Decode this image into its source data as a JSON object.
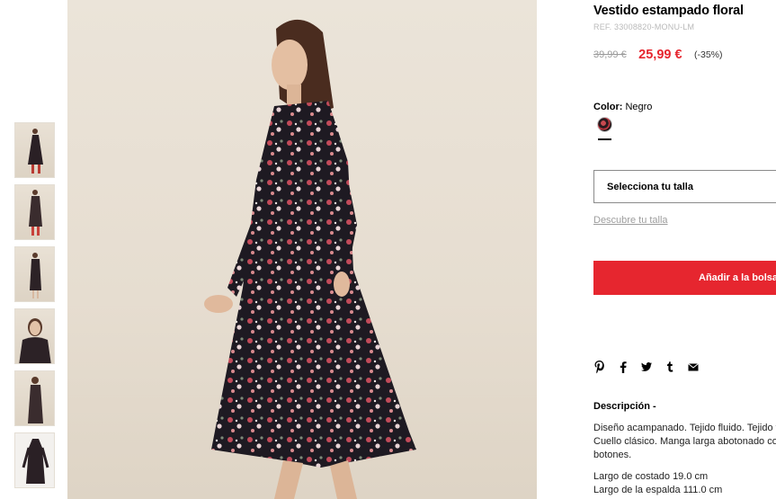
{
  "product": {
    "title": "Vestido estampado floral",
    "ref": "REF. 33008820-MONU-LM",
    "old_price": "39,99 €",
    "new_price": "25,99 €",
    "discount": "(-35%)"
  },
  "color": {
    "label": "Color:",
    "value": "Negro"
  },
  "size": {
    "select_label": "Selecciona tu talla",
    "guide_link": "Descubre tu talla"
  },
  "cart": {
    "add_label": "Añadir a la bolsa"
  },
  "share_icons": [
    "pinterest-icon",
    "facebook-icon",
    "twitter-icon",
    "tumblr-icon",
    "email-icon"
  ],
  "description": {
    "title": "Descripción -",
    "text": "Diseño acampanado. Tejido fluido. Tejido floral. Cuello clásico. Manga larga abotonado con botones.",
    "specs": [
      "Largo de costado 19.0 cm",
      "Largo de la espalda 111.0 cm"
    ]
  },
  "colors": {
    "accent": "#e6262f"
  }
}
